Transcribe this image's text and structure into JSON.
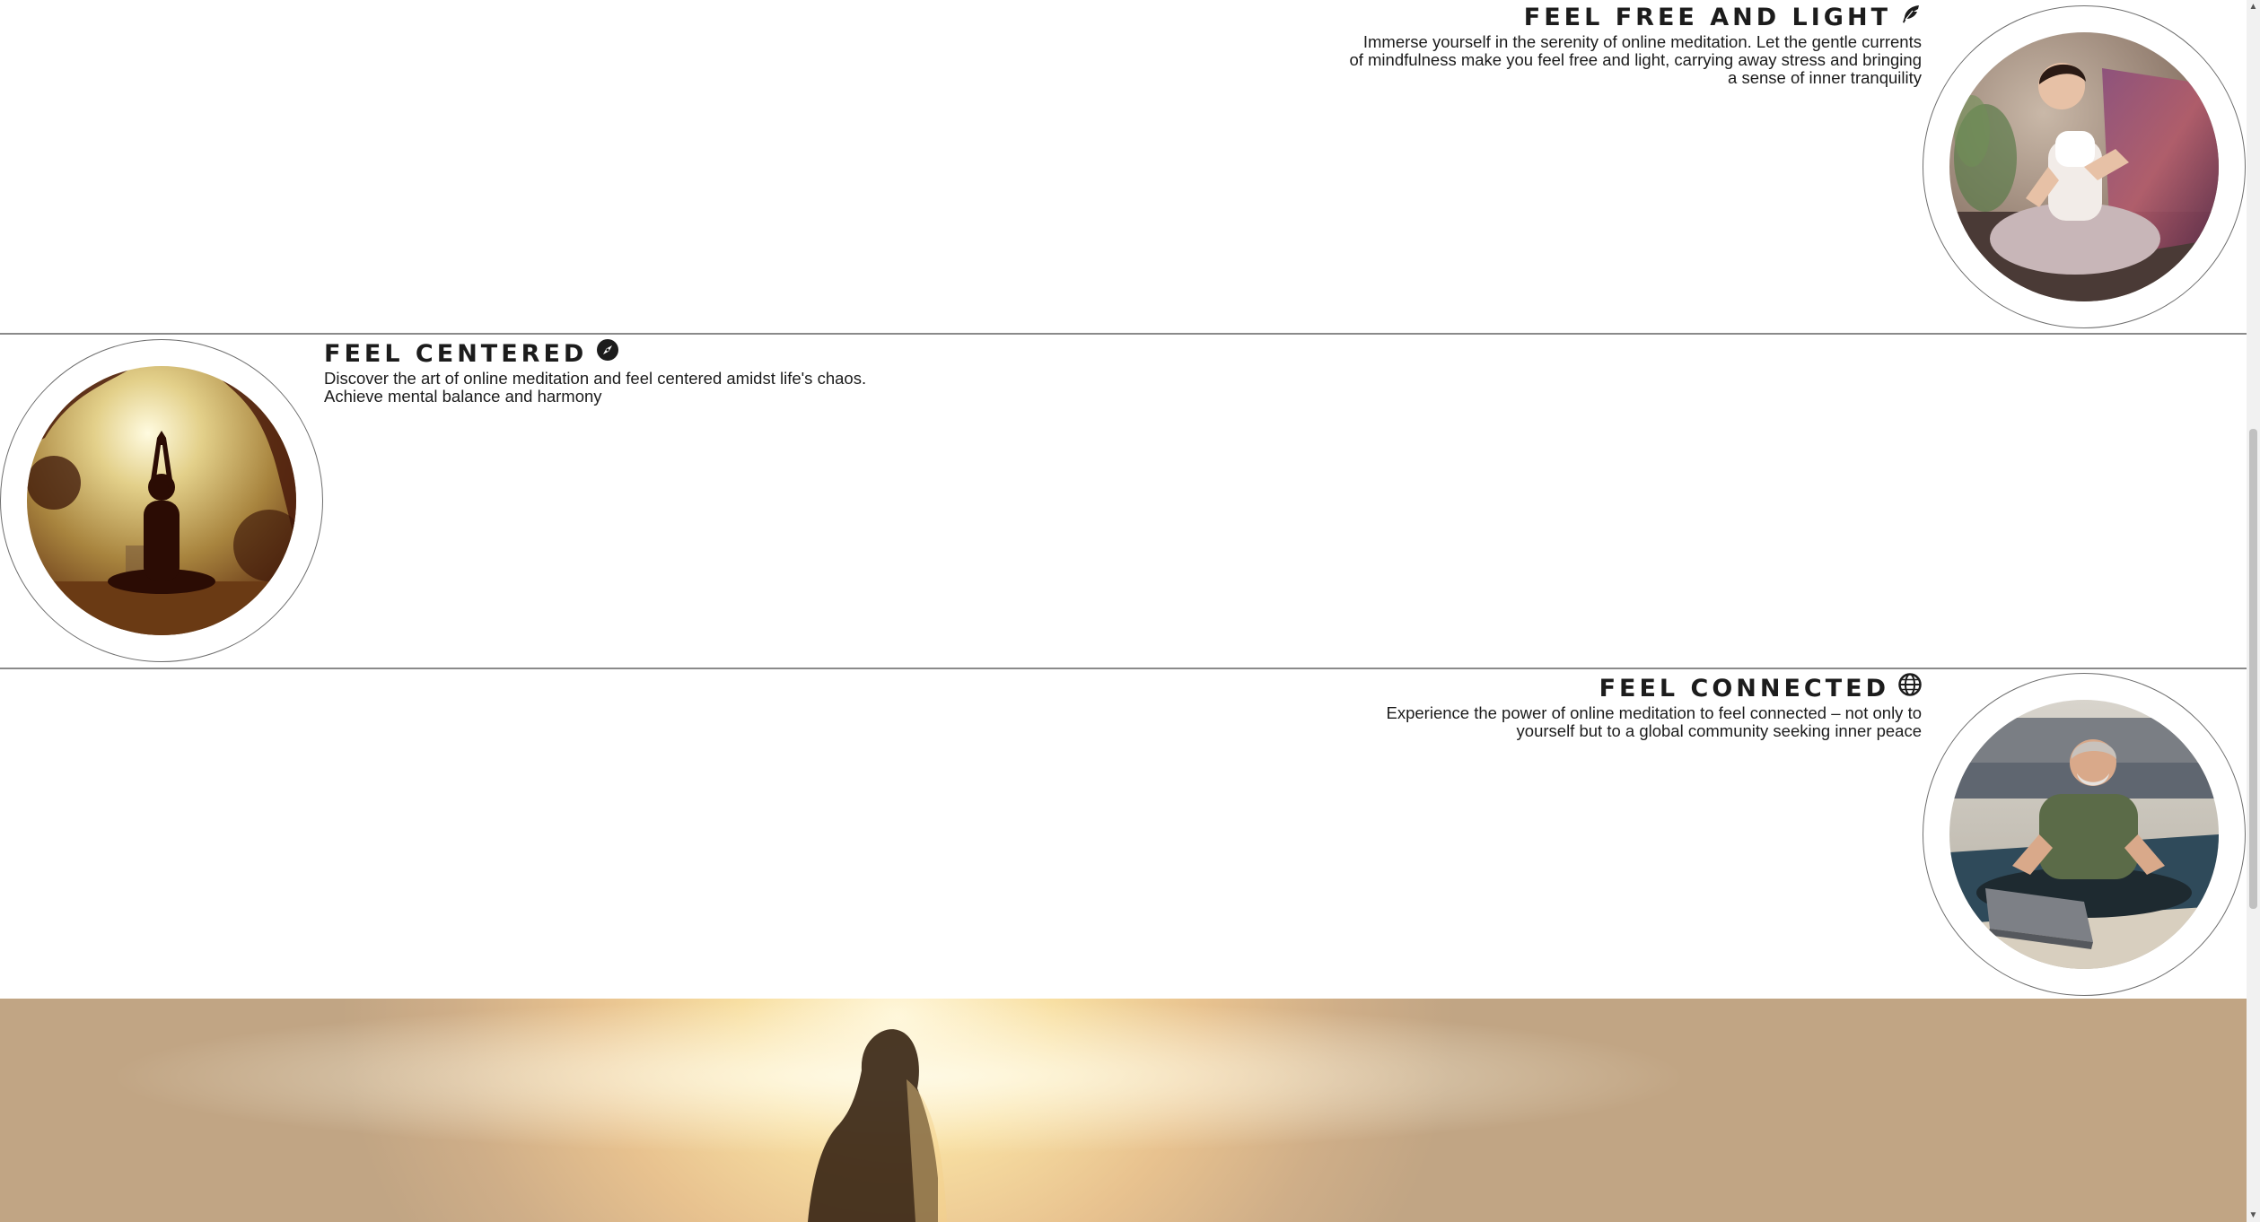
{
  "sections": [
    {
      "title": "FEEL FREE AND LIGHT",
      "icon": "feather-icon",
      "description": [
        "Immerse yourself in the serenity of online meditation. Let the gentle currents",
        "of mindfulness make you feel free and light, carrying away stress and bringing",
        "a sense of inner tranquility"
      ]
    },
    {
      "title": "FEEL CENTERED",
      "icon": "compass-icon",
      "description": [
        "Discover the art of online meditation and feel centered amidst life's chaos.",
        "Achieve mental balance and harmony"
      ]
    },
    {
      "title": "FEEL CONNECTED",
      "icon": "globe-icon",
      "description": [
        "Experience the power of online meditation to feel connected – not only to",
        "yourself but to a global community seeking inner peace"
      ]
    }
  ],
  "scrollbar": {
    "up_arrow": "▲",
    "down_arrow": "▼"
  }
}
